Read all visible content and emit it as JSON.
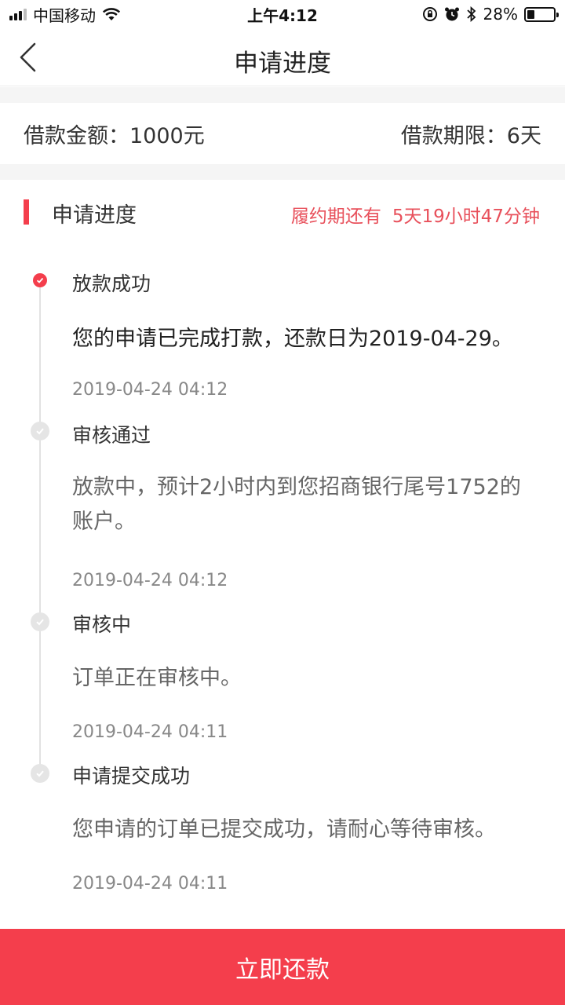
{
  "status_bar": {
    "carrier": "中国移动",
    "time": "上午4:12",
    "battery_percent": "28%",
    "battery_level": 0.28,
    "icons": [
      "signal-icon",
      "wifi-icon",
      "rotation-lock-icon",
      "alarm-icon",
      "bluetooth-icon",
      "battery-icon"
    ]
  },
  "nav": {
    "title": "申请进度",
    "back_icon": "chevron-left-icon"
  },
  "summary": {
    "amount": "借款金额：1000元",
    "term": "借款期限：6天"
  },
  "section": {
    "title": "申请进度",
    "countdown_label": "履约期还有",
    "countdown_value": "5天19小时47分钟"
  },
  "timeline": [
    {
      "title": "放款成功",
      "description": "您的申请已完成打款，还款日为2019-04-29。",
      "time": "2019-04-24 04:12",
      "active": true
    },
    {
      "title": "审核通过",
      "description": "放款中，预计2小时内到您招商银行尾号1752的账户。",
      "time": "2019-04-24 04:12",
      "active": false
    },
    {
      "title": "审核中",
      "description": "订单正在审核中。",
      "time": "2019-04-24 04:11",
      "active": false
    },
    {
      "title": "申请提交成功",
      "description": "您申请的订单已提交成功，请耐心等待审核。",
      "time": "2019-04-24 04:11",
      "active": false
    }
  ],
  "footer": {
    "button_label": "立即还款"
  },
  "colors": {
    "accent": "#f43e4c",
    "countdown": "#e8505b",
    "inactive_dot": "#e5e5e5",
    "divider": "#f5f5f5"
  }
}
